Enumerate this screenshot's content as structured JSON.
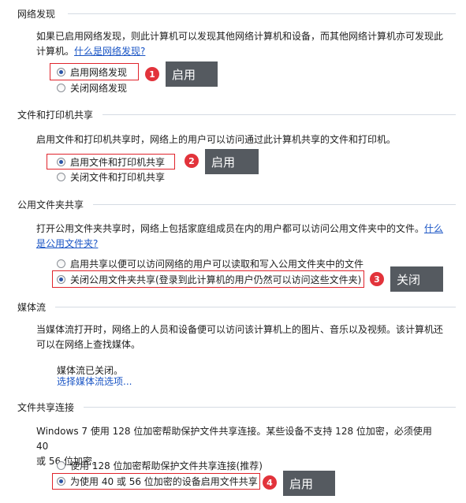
{
  "network_discovery": {
    "header": "网络发现",
    "desc": "如果已启用网络发现，则此计算机可以发现其他网络计算机和设备，而其他网络计算机亦可发现此",
    "desc_line2": "计算机。",
    "link": "什么是网络发现?",
    "options": [
      "启用网络发现",
      "关闭网络发现"
    ],
    "selected": 0,
    "badge": "1",
    "callout": "启用"
  },
  "file_printer": {
    "header": "文件和打印机共享",
    "desc": "启用文件和打印机共享时，网络上的用户可以访问通过此计算机共享的文件和打印机。",
    "options": [
      "启用文件和打印机共享",
      "关闭文件和打印机共享"
    ],
    "selected": 0,
    "badge": "2",
    "callout": "启用"
  },
  "public_folder": {
    "header": "公用文件夹共享",
    "desc": "打开公用文件夹共享时，网络上包括家庭组成员在内的用户都可以访问公用文件夹中的文件。",
    "link_part1": "什么",
    "link_part2": "是公用文件夹?",
    "options": [
      "启用共享以便可以访问网络的用户可以读取和写入公用文件夹中的文件",
      "关闭公用文件夹共享(登录到此计算机的用户仍然可以访问这些文件夹)"
    ],
    "selected": 1,
    "badge": "3",
    "callout": "关闭"
  },
  "media_streaming": {
    "header": "媒体流",
    "desc": "当媒体流打开时，网络上的人员和设备便可以访问该计算机上的图片、音乐以及视频。该计算机还",
    "desc_line2": "可以在网络上查找媒体。",
    "status": "媒体流已关闭。",
    "link": "选择媒体流选项..."
  },
  "file_sharing_connections": {
    "header": "文件共享连接",
    "desc": "Windows 7 使用 128 位加密帮助保护文件共享连接。某些设备不支持 128 位加密，必须使用 40",
    "desc_line2": "或 56 位加密。",
    "options": [
      "使用 128 位加密帮助保护文件共享连接(推荐)",
      "为使用 40 或 56 位加密的设备启用文件共享"
    ],
    "selected": 1,
    "badge": "4",
    "callout": "启用"
  },
  "colors": {
    "highlight_border": "#e0242c",
    "badge": "#e2333b",
    "callout_bg": "#555a60",
    "link": "#1a55c5",
    "rule": "#d5dbe3"
  }
}
